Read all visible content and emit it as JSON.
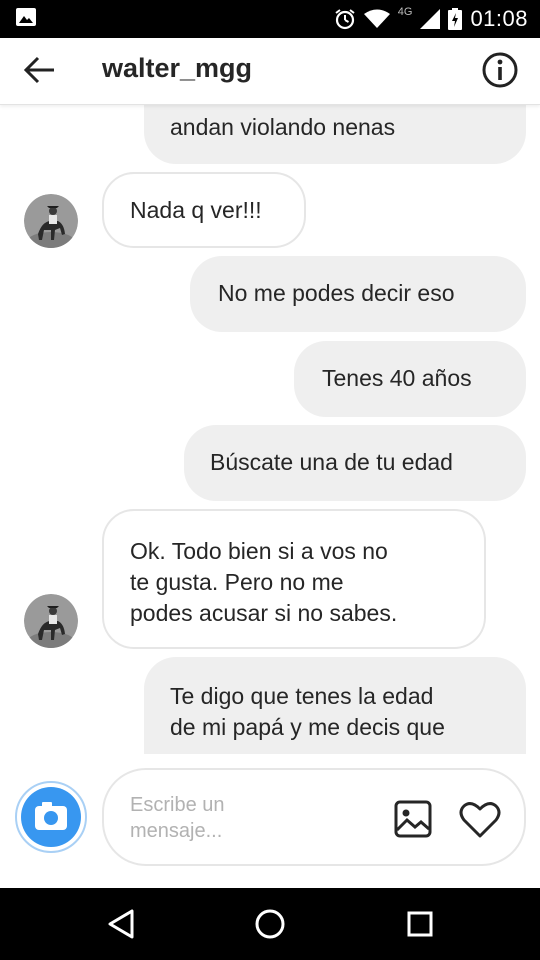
{
  "status_bar": {
    "time": "01:08",
    "network": "4G"
  },
  "header": {
    "username": "walter_mgg"
  },
  "messages": [
    {
      "direction": "out",
      "text": "andan violando nenas"
    },
    {
      "direction": "in",
      "text": "Nada q ver!!!"
    },
    {
      "direction": "out",
      "text": "No me podes decir eso"
    },
    {
      "direction": "out",
      "text": "Tenes 40 años"
    },
    {
      "direction": "out",
      "text": "Búscate una de tu edad"
    },
    {
      "direction": "in",
      "lines": [
        "Ok. Todo bien si a vos no",
        "te gusta. Pero no me",
        "podes acusar si no sabes."
      ]
    },
    {
      "direction": "out",
      "lines": [
        "Te digo que tenes la edad",
        "de mi papá y me decis que"
      ]
    }
  ],
  "composer": {
    "placeholder_lines": [
      "Escribe un",
      "mensaje..."
    ]
  },
  "colors": {
    "outgoing_bubble": "#efefef",
    "incoming_border": "#e6e6e6",
    "camera_blue": "#3897f0"
  }
}
